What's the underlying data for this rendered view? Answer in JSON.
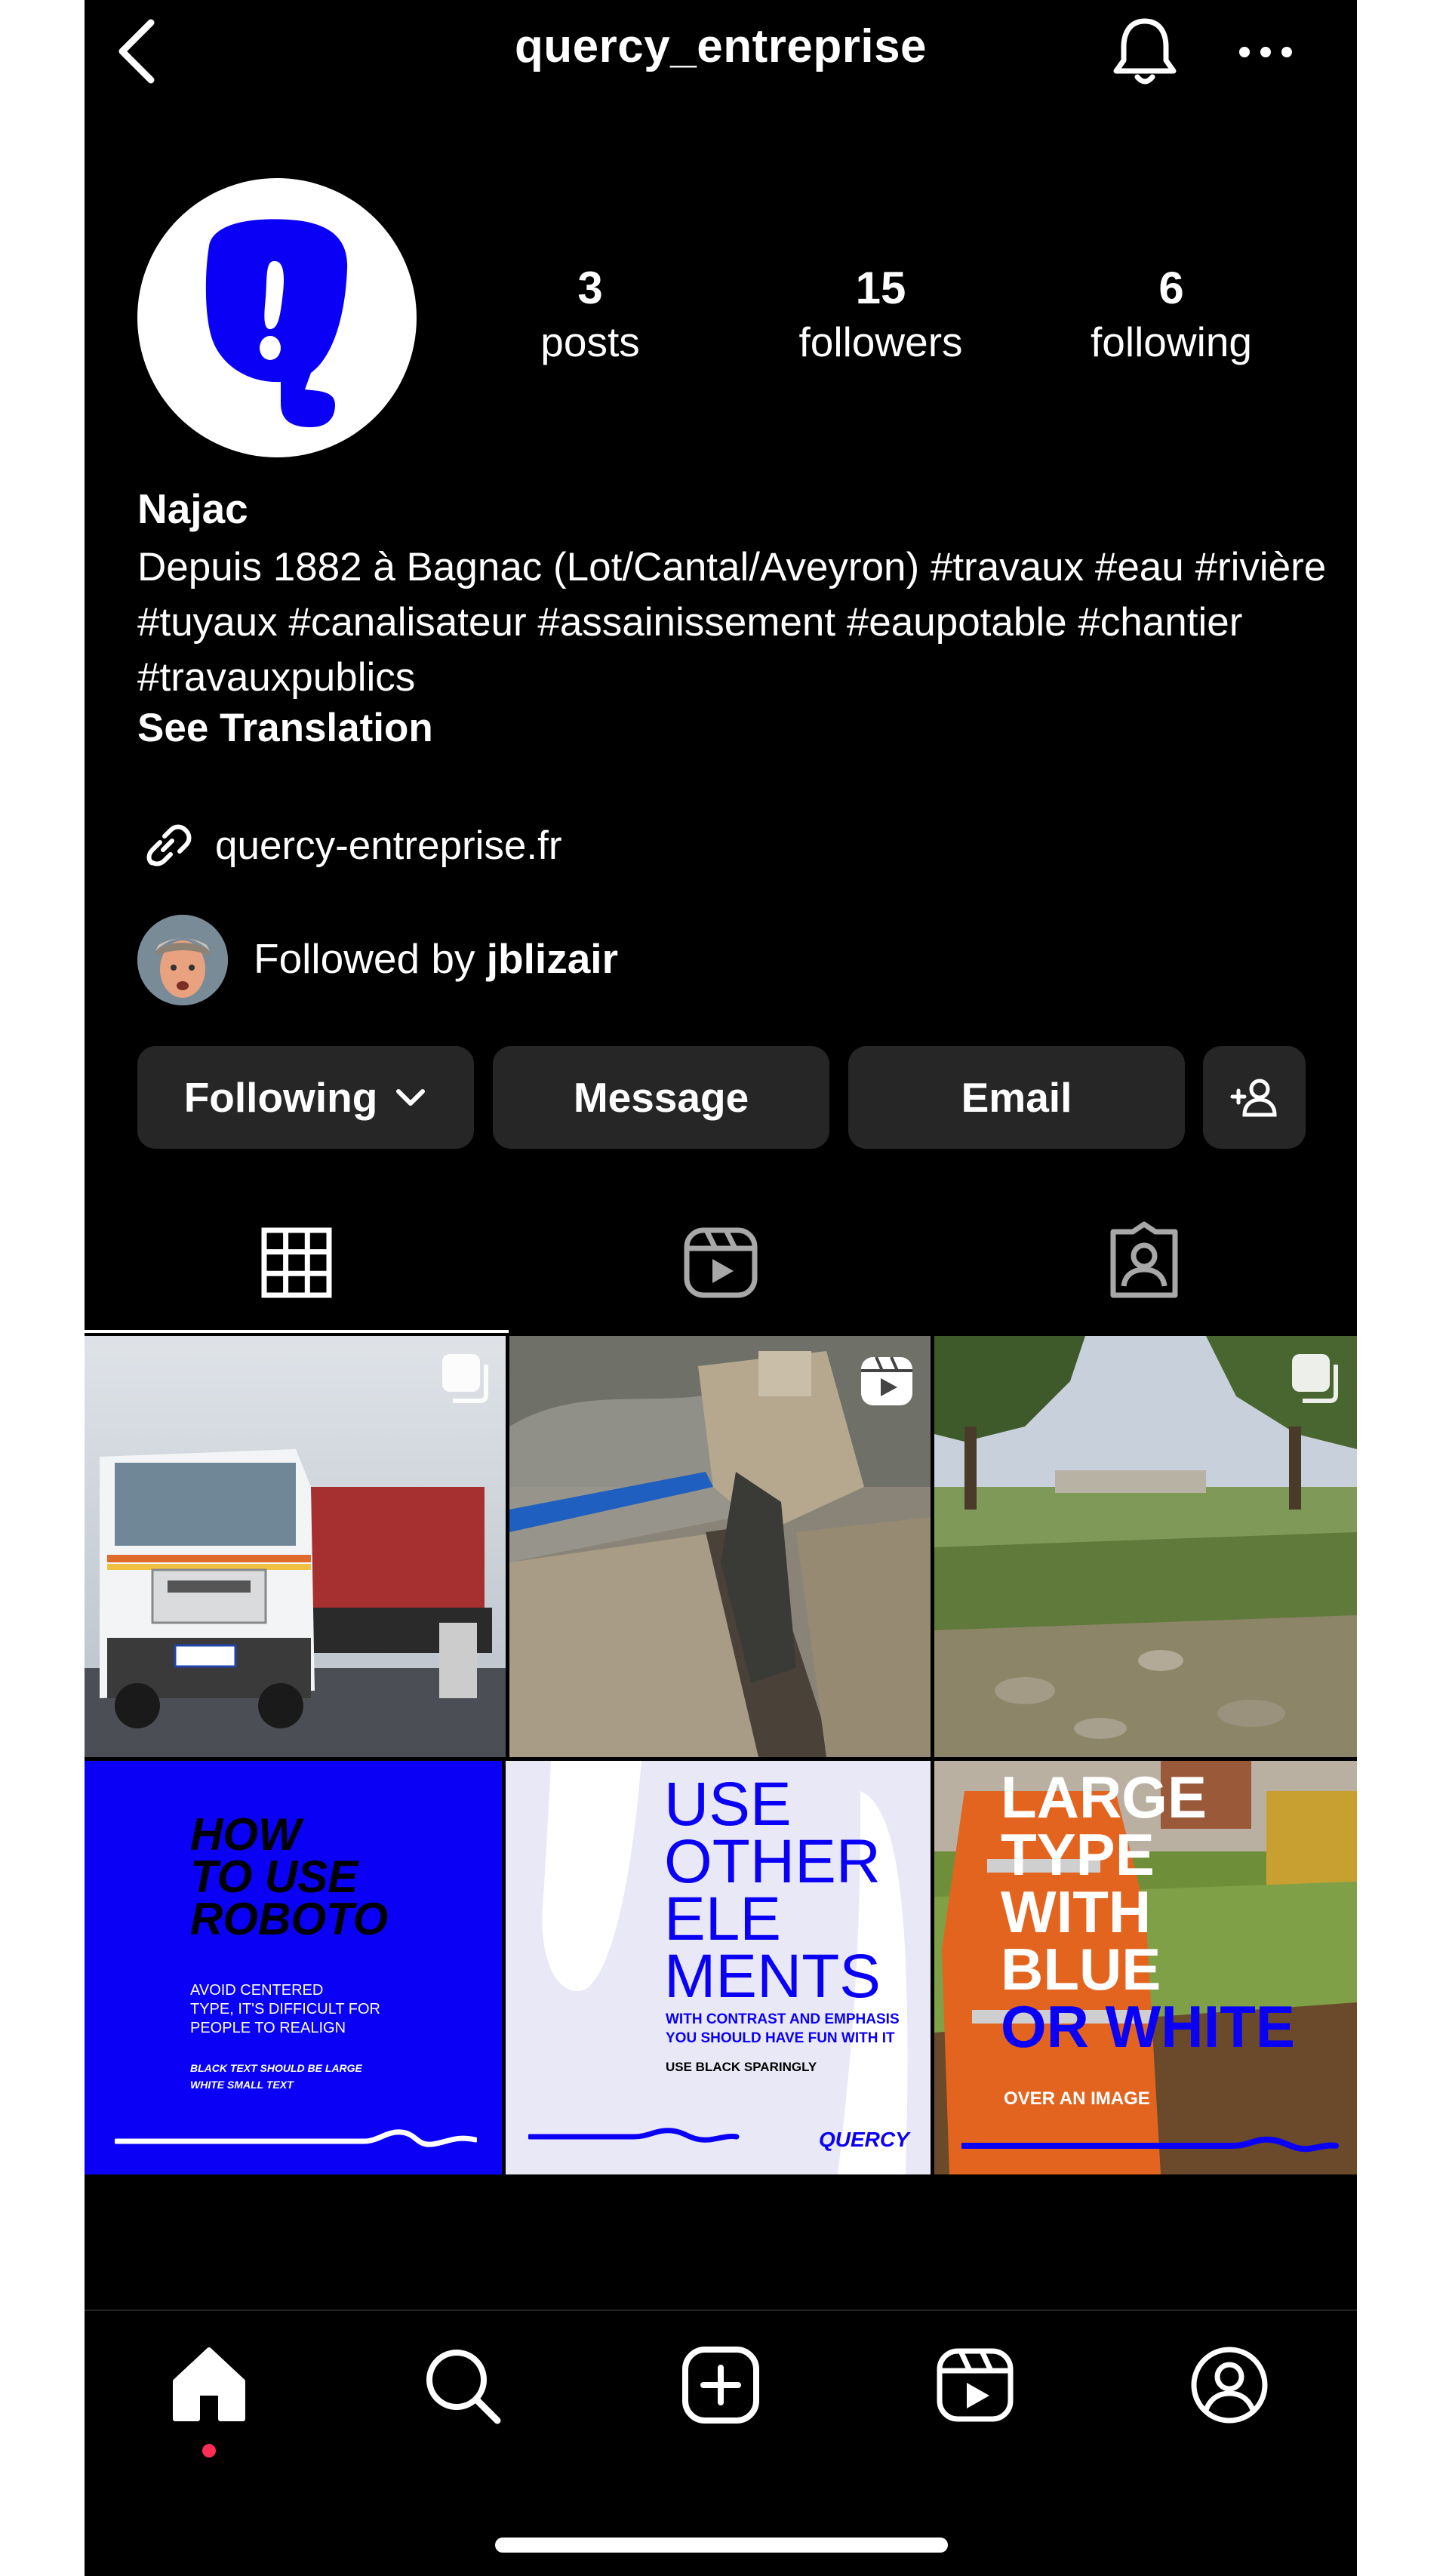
{
  "header": {
    "username": "quercy_entreprise",
    "back_icon": "chevron-left-icon",
    "bell_icon": "bell-icon",
    "more_icon": "more-horizontal-icon"
  },
  "stats": [
    {
      "value": "3",
      "label": "posts"
    },
    {
      "value": "15",
      "label": "followers"
    },
    {
      "value": "6",
      "label": "following"
    }
  ],
  "bio": {
    "name": "Najac",
    "text": "Depuis 1882 à Bagnac (Lot/Cantal/Aveyron) #travaux #eau #rivière #tuyaux #canalisateur #assainissement #eaupotable #chantier #travauxpublics",
    "translation": "See Translation",
    "link": "quercy-entreprise.fr",
    "followed_by_prefix": "Followed by ",
    "followed_by_user": "jblizair"
  },
  "buttons": {
    "following": "Following",
    "message": "Message",
    "email": "Email",
    "add_user_icon": "add-user-icon"
  },
  "tabs": [
    "grid-icon",
    "reels-icon",
    "tagged-icon"
  ],
  "posts": {
    "p4": {
      "title_lines": [
        "HOW",
        "TO USE",
        "ROBOTO"
      ],
      "sub_lines": [
        "AVOID CENTERED",
        "TYPE, IT'S DIFFICULT FOR",
        "PEOPLE TO REALIGN"
      ],
      "note_lines": [
        "BLACK TEXT SHOULD BE LARGE",
        "WHITE SMALL TEXT"
      ]
    },
    "p5": {
      "title_lines": [
        "USE",
        "OTHER",
        "ELE",
        "MENTS"
      ],
      "sub_lines": [
        "WITH CONTRAST AND EMPHASIS",
        "YOU SHOULD HAVE FUN WITH IT"
      ],
      "note": "USE BLACK SPARINGLY",
      "brand": "QUERCY"
    },
    "p6": {
      "title_lines": [
        "LARGE",
        "TYPE",
        "WITH",
        "BLUE"
      ],
      "blue_line": "OR WHITE",
      "note": "OVER AN IMAGE"
    }
  },
  "nav": [
    "home-icon",
    "search-icon",
    "create-icon",
    "reels-icon",
    "profile-icon"
  ],
  "colors": {
    "background": "#000000",
    "button_bg": "#262626",
    "brand_blue": "#0a00f5",
    "notification_dot": "#ff2d55"
  }
}
